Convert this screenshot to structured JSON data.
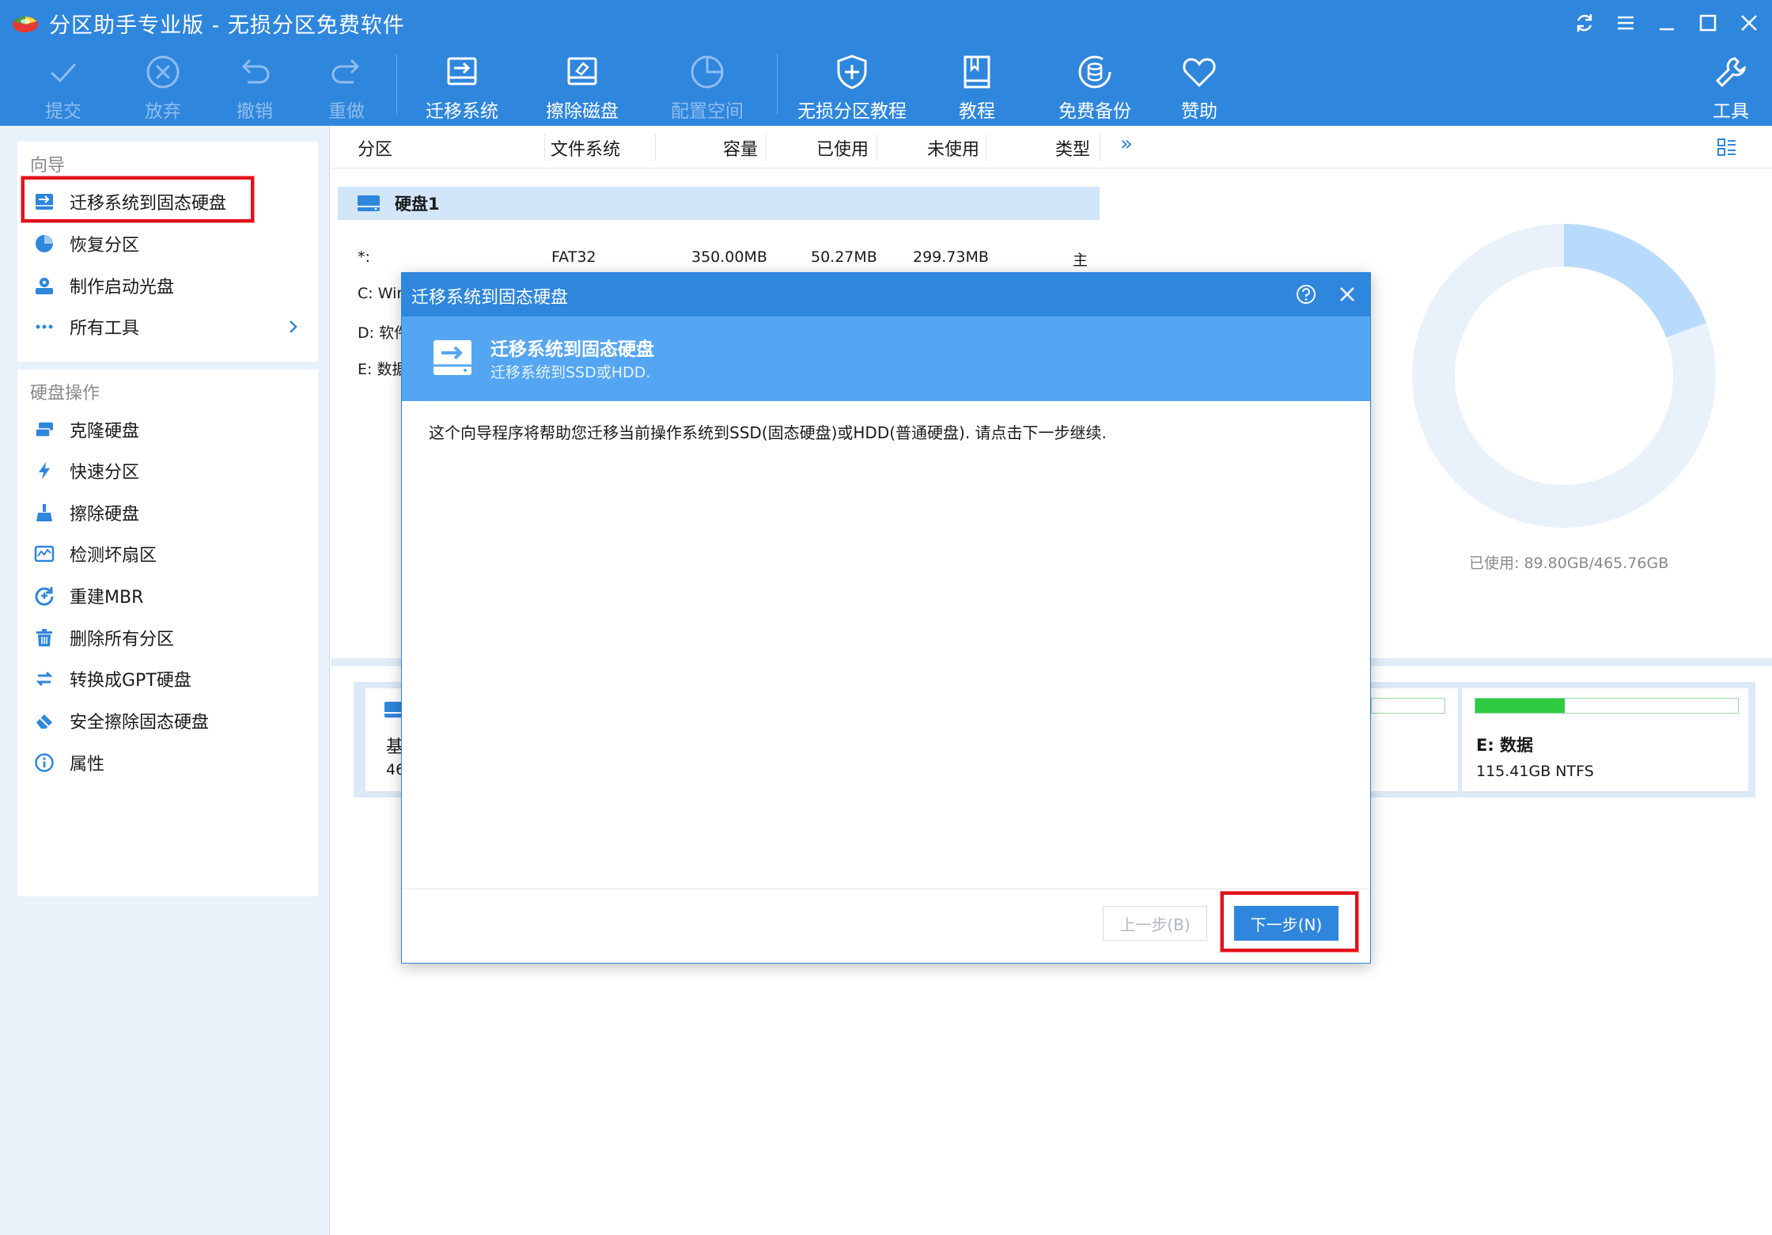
{
  "app": {
    "title": "分区助手专业版 - 无损分区免费软件",
    "icons": [
      "refresh-icon",
      "menu-icon",
      "minimize-icon",
      "maximize-icon",
      "close-icon"
    ]
  },
  "toolbar": {
    "commit": "提交",
    "discard": "放弃",
    "undo": "撤销",
    "redo": "重做",
    "migrate_os": "迁移系统",
    "wipe_disk": "擦除磁盘",
    "allocate_space": "配置空间",
    "tutorial_lossless": "无损分区教程",
    "tutorial": "教程",
    "free_backup": "免费备份",
    "donate": "赞助",
    "tools": "工具"
  },
  "sidebar": {
    "wizard_title": "向导",
    "wizard_items": [
      {
        "label": "迁移系统到固态硬盘",
        "icon": "migrate-disk-icon"
      },
      {
        "label": "恢复分区",
        "icon": "pie-icon"
      },
      {
        "label": "制作启动光盘",
        "icon": "boot-disc-icon"
      },
      {
        "label": "所有工具",
        "icon": "dots-icon"
      }
    ],
    "disk_ops_title": "硬盘操作",
    "disk_ops_items": [
      {
        "label": "克隆硬盘",
        "icon": "clone-disk-icon"
      },
      {
        "label": "快速分区",
        "icon": "lightning-icon"
      },
      {
        "label": "擦除硬盘",
        "icon": "broom-icon"
      },
      {
        "label": "检测坏扇区",
        "icon": "scan-icon"
      },
      {
        "label": "重建MBR",
        "icon": "rebuild-icon"
      },
      {
        "label": "删除所有分区",
        "icon": "trash-icon"
      },
      {
        "label": "转换成GPT硬盘",
        "icon": "convert-icon"
      },
      {
        "label": "安全擦除固态硬盘",
        "icon": "eraser-icon"
      },
      {
        "label": "属性",
        "icon": "info-icon"
      }
    ]
  },
  "table": {
    "columns": [
      "分区",
      "文件系统",
      "容量",
      "已使用",
      "未使用",
      "类型"
    ],
    "more": "»",
    "disk1_label": "硬盘1",
    "rows": [
      {
        "partition": "*:",
        "fs": "FAT32",
        "capacity": "350.00MB",
        "used": "50.27MB",
        "unused": "299.73MB",
        "type": "主"
      },
      {
        "partition": "C: Win"
      },
      {
        "partition": "D: 软件"
      },
      {
        "partition": "E: 数据"
      }
    ]
  },
  "usage": {
    "label": "已使用: 89.80GB/465.76GB",
    "used_fraction": 0.193
  },
  "disk_map": {
    "left_card_line1": "基",
    "left_card_line2": "46",
    "e_partition_name": "E: 数据",
    "e_partition_size": "115.41GB NTFS",
    "e_used_fraction": 0.34,
    "bar_color": "#2ecc40"
  },
  "dialog": {
    "title": "迁移系统到固态硬盘",
    "heading": "迁移系统到固态硬盘",
    "subheading": "迁移系统到SSD或HDD.",
    "body": "这个向导程序将帮助您迁移当前操作系统到SSD(固态硬盘)或HDD(普通硬盘). 请点击下一步继续.",
    "prev_button": "上一步(B)",
    "next_button": "下一步(N)"
  },
  "colors": {
    "accent": "#2f86dd",
    "banner": "#55a6f2",
    "highlight": "#e0121b"
  }
}
